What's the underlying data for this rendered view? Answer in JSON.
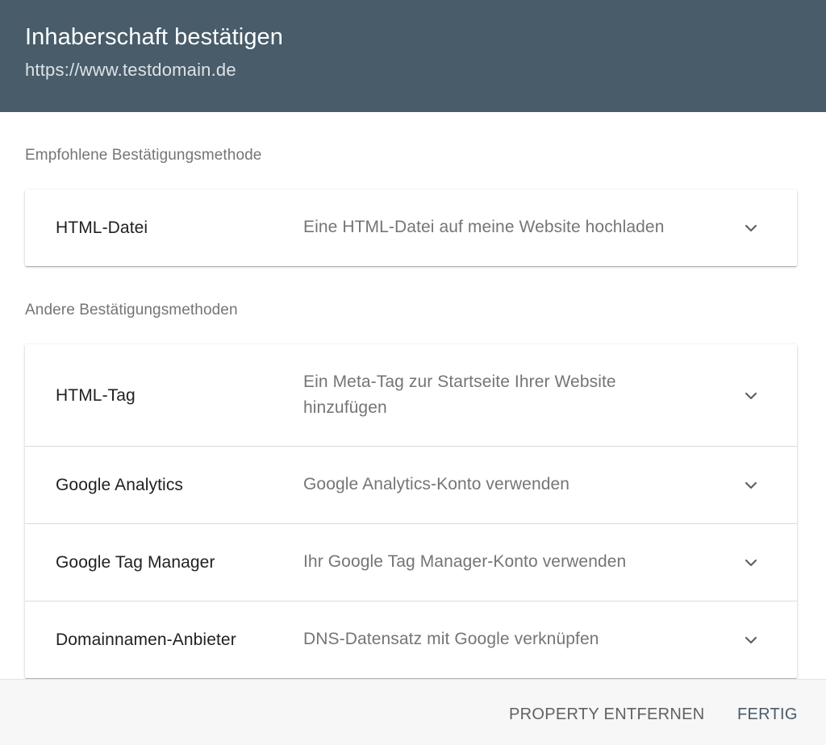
{
  "header": {
    "title": "Inhaberschaft bestätigen",
    "url": "https://www.testdomain.de"
  },
  "recommended": {
    "section_label": "Empfohlene Bestätigungsmethode",
    "items": [
      {
        "title": "HTML-Datei",
        "description": "Eine HTML-Datei auf meine Website hochladen",
        "icon": "chevron-down-icon"
      }
    ]
  },
  "other": {
    "section_label": "Andere Bestätigungsmethoden",
    "items": [
      {
        "title": "HTML-Tag",
        "description_line1": "Ein Meta-Tag zur Startseite Ihrer Website",
        "description_line2": "hinzufügen",
        "icon": "chevron-down-icon"
      },
      {
        "title": "Google Analytics",
        "description": "Google Analytics-Konto verwenden",
        "icon": "chevron-down-icon"
      },
      {
        "title": "Google Tag Manager",
        "description": "Ihr Google Tag Manager-Konto verwenden",
        "icon": "chevron-down-icon"
      },
      {
        "title": "Domainnamen-Anbieter",
        "description": "DNS-Datensatz mit Google verknüpfen",
        "icon": "chevron-down-icon"
      }
    ]
  },
  "footer": {
    "remove_label": "PROPERTY ENTFERNEN",
    "done_label": "FERTIG"
  },
  "colors": {
    "header_bg": "#485c69",
    "primary_text": "#212121",
    "secondary_text": "#757575",
    "accent": "#485c69"
  }
}
